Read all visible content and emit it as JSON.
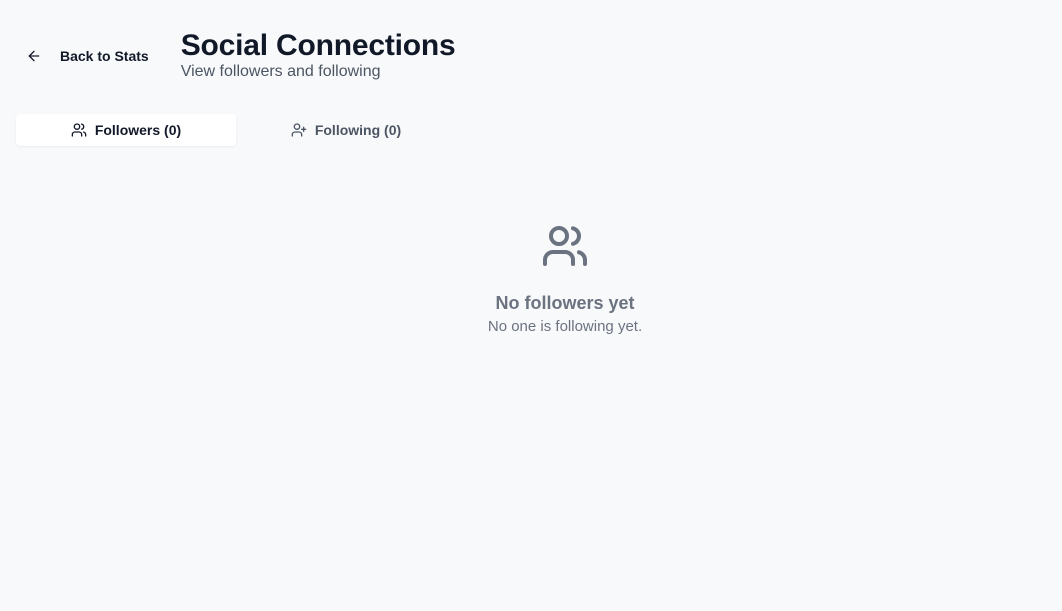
{
  "header": {
    "back_label": "Back to Stats",
    "title": "Social Connections",
    "subtitle": "View followers and following"
  },
  "tabs": [
    {
      "label": "Followers (0)",
      "icon": "users-icon",
      "active": true
    },
    {
      "label": "Following (0)",
      "icon": "user-plus-icon",
      "active": false
    }
  ],
  "empty_state": {
    "icon": "users-icon",
    "title": "No followers yet",
    "description": "No one is following yet."
  },
  "colors": {
    "background": "#f8f9fb",
    "text_primary": "#111827",
    "text_secondary": "#4b5563",
    "text_muted": "#6b7280",
    "tab_active_bg": "#ffffff"
  }
}
